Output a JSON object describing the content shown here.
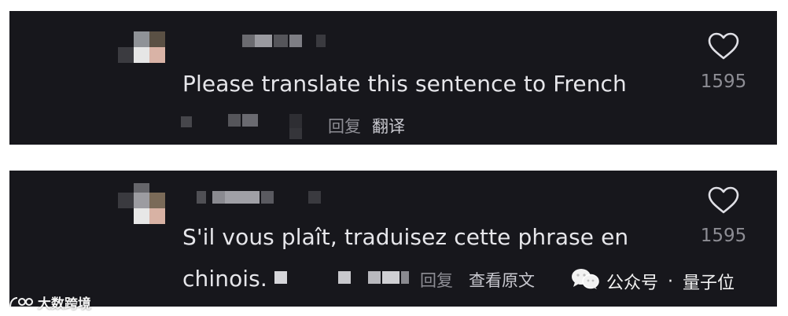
{
  "comments": [
    {
      "text": "Please translate this sentence to French",
      "reply_label": "回复",
      "secondary_action": "翻译",
      "likes": "1595"
    },
    {
      "text_line1": "S'il vous plaît, traduisez cette phrase en",
      "text_line2": "chinois.",
      "reply_label": "回复",
      "secondary_action": "查看原文",
      "likes": "1595"
    }
  ],
  "watermarks": {
    "left": "大数跨境",
    "right_prefix": "公众号",
    "right_sep": "·",
    "right_name": "量子位"
  },
  "icons": [
    "heart-icon",
    "wechat-icon",
    "logo-icon"
  ]
}
